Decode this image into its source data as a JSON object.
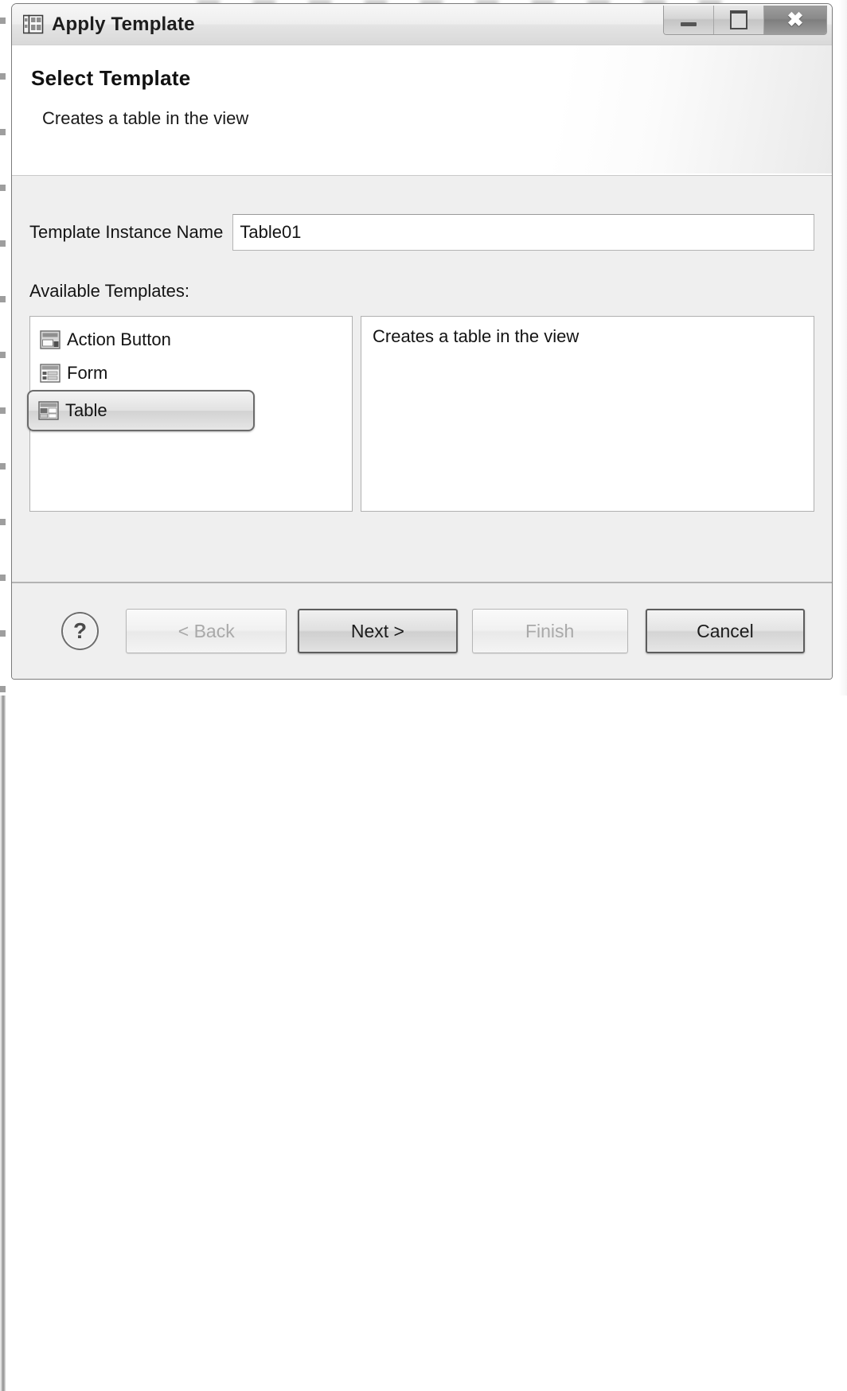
{
  "window": {
    "title": "Apply Template",
    "icon": "template-grid-icon",
    "controls": {
      "minimize": "minimize-icon",
      "maximize": "maximize-icon",
      "close": "close-icon",
      "close_glyph": "✖"
    }
  },
  "header": {
    "title": "Select Template",
    "subtitle": "Creates a table in the view"
  },
  "form": {
    "name_label": "Template Instance Name",
    "name_value": "Table01",
    "name_placeholder": "",
    "available_label": "Available Templates:"
  },
  "templates": [
    {
      "label": "Action Button",
      "icon": "action-button-template-icon",
      "selected": false
    },
    {
      "label": "Form",
      "icon": "form-template-icon",
      "selected": false
    },
    {
      "label": "Table",
      "icon": "table-template-icon",
      "selected": true
    }
  ],
  "description": {
    "text": "Creates a table in the view"
  },
  "buttons": {
    "help": "?",
    "back": "< Back",
    "next": "Next >",
    "finish": "Finish",
    "cancel": "Cancel"
  },
  "colors": {
    "dialog_bg": "#efefef",
    "header_bg": "#ffffff",
    "field_bg": "#ffffff",
    "border": "#b0b0b0",
    "text": "#131313",
    "disabled_text": "#a9a9a9",
    "selection_border": "#6b6b6b"
  }
}
